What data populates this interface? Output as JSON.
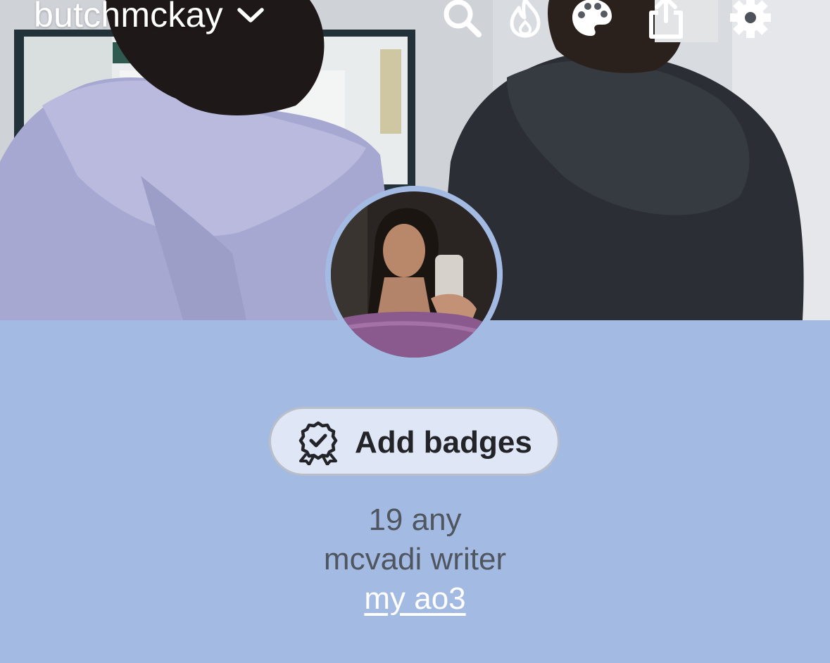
{
  "header": {
    "blog_name": "butchmckay",
    "icons": [
      "search-icon",
      "flame-icon",
      "palette-icon",
      "share-icon",
      "gear-icon"
    ]
  },
  "profile": {
    "badges_button_label": "Add badges",
    "description_lines": [
      "19 any",
      "mcvadi writer"
    ],
    "link_text": "my ao3"
  },
  "colors": {
    "page_background": "#a3bae3",
    "button_background": "#dfe6f6",
    "link_color": "#ffffff",
    "text_color": "#50565f"
  }
}
